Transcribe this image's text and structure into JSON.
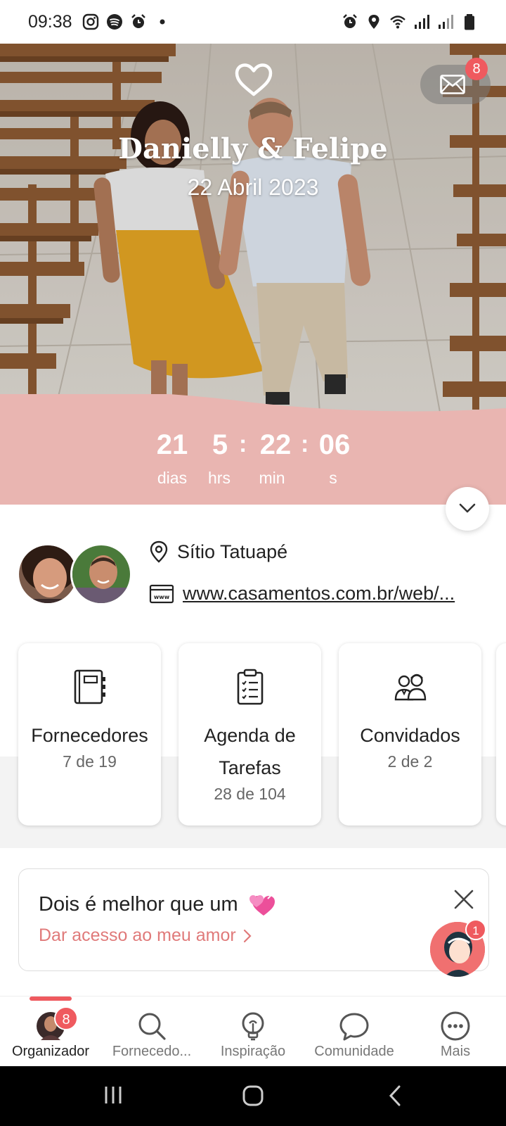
{
  "status_bar": {
    "time": "09:38",
    "left_icons": [
      "instagram-icon",
      "spotify-icon",
      "alarm-icon",
      "dot-icon"
    ],
    "right_icons": [
      "alarm-icon",
      "location-icon",
      "wifi-icon",
      "signal-icon",
      "signal-icon",
      "battery-icon"
    ]
  },
  "hero": {
    "names": "Danielly & Felipe",
    "date": "22 Abril 2023",
    "mail_badge": "8"
  },
  "countdown": {
    "days": "21",
    "days_label": "dias",
    "hours": "5",
    "hours_label": "hrs",
    "minutes": "22",
    "minutes_label": "min",
    "seconds": "06",
    "seconds_label": "s",
    "separator": ":"
  },
  "info": {
    "venue": "Sítio Tatuapé",
    "website": "www.casamentos.com.br/web/..."
  },
  "cards": [
    {
      "title": "Fornecedores",
      "sub": "7 de 19",
      "icon": "notebook-icon"
    },
    {
      "title": "Agenda de Tarefas",
      "sub": "28 de 104",
      "icon": "clipboard-checklist-icon"
    },
    {
      "title": "Convidados",
      "sub": "2 de 2",
      "icon": "guests-icon"
    }
  ],
  "banner": {
    "title": "Dois é melhor que um",
    "cta": "Dar acesso ao meu amor",
    "assistant_badge": "1"
  },
  "bottom_nav": {
    "items": [
      {
        "label": "Organizador",
        "badge": "8"
      },
      {
        "label": "Fornecedo..."
      },
      {
        "label": "Inspiração"
      },
      {
        "label": "Comunidade"
      },
      {
        "label": "Mais"
      }
    ]
  },
  "colors": {
    "accent": "#ef5a5f",
    "countdown_bg": "#e9b5b1",
    "link_pink": "#e07a7a"
  }
}
